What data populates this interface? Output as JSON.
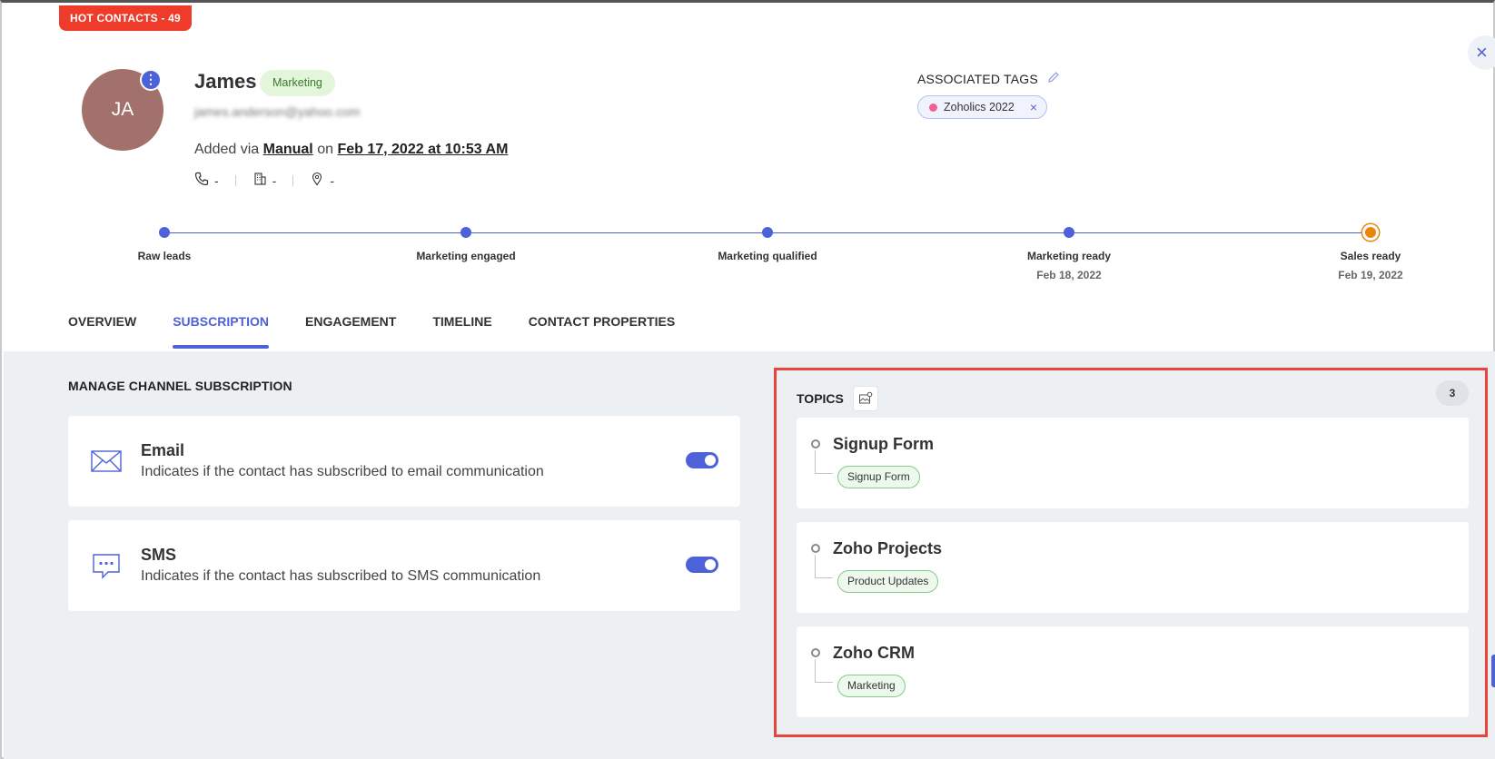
{
  "badge": {
    "label": "HOT CONTACTS - 49"
  },
  "close_icon": "×",
  "contact": {
    "initials": "JA",
    "menu_glyph": "⋮",
    "name": "James",
    "segment": "Marketing",
    "email": "james.anderson@yahoo.com",
    "added_prefix": "Added via",
    "added_source": "Manual",
    "added_on_word": "on",
    "added_date": "Feb 17, 2022 at 10:53 AM",
    "phone": "-",
    "company": "-",
    "location": "-"
  },
  "tags": {
    "title": "ASSOCIATED TAGS",
    "items": [
      {
        "label": "Zoholics 2022",
        "color": "#f06292"
      }
    ],
    "remove_glyph": "×"
  },
  "lifecycle": {
    "stages": [
      {
        "label": "Raw leads",
        "date": ""
      },
      {
        "label": "Marketing engaged",
        "date": ""
      },
      {
        "label": "Marketing qualified",
        "date": ""
      },
      {
        "label": "Marketing ready",
        "date": "Feb 18, 2022"
      },
      {
        "label": "Sales ready",
        "date": "Feb 19, 2022"
      }
    ],
    "current_index": 4
  },
  "tabs": [
    {
      "label": "OVERVIEW",
      "active": false
    },
    {
      "label": "SUBSCRIPTION",
      "active": true
    },
    {
      "label": "ENGAGEMENT",
      "active": false
    },
    {
      "label": "TIMELINE",
      "active": false
    },
    {
      "label": "CONTACT PROPERTIES",
      "active": false
    }
  ],
  "channels": {
    "title": "MANAGE CHANNEL SUBSCRIPTION",
    "items": [
      {
        "name": "Email",
        "description": "Indicates if the contact has subscribed to email communication",
        "icon": "envelope-icon",
        "enabled": true
      },
      {
        "name": "SMS",
        "description": "Indicates if the contact has subscribed to SMS communication",
        "icon": "sms-icon",
        "enabled": true
      }
    ]
  },
  "topics": {
    "title": "TOPICS",
    "count": "3",
    "items": [
      {
        "name": "Signup Form",
        "chip": "Signup Form"
      },
      {
        "name": "Zoho Projects",
        "chip": "Product Updates"
      },
      {
        "name": "Zoho CRM",
        "chip": "Marketing"
      }
    ]
  },
  "colors": {
    "accent": "#4d62d8",
    "hot": "#ef3b2a",
    "current_stage": "#e8860d",
    "highlight": "#e8463d"
  }
}
